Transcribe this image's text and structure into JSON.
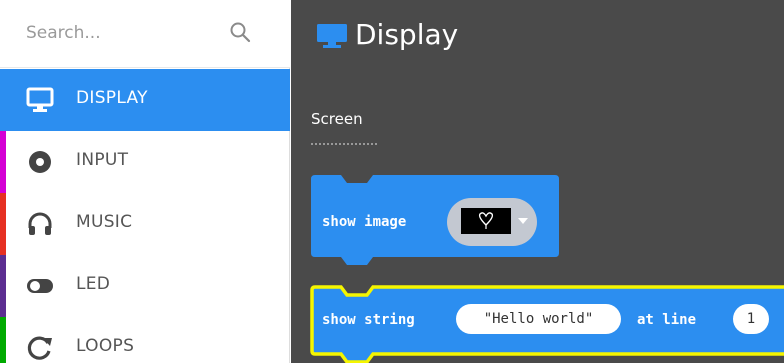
{
  "search": {
    "placeholder": "Search..."
  },
  "sidebar": {
    "items": [
      {
        "label": "DISPLAY",
        "icon": "monitor-icon",
        "color": "#2c8ef0",
        "active": true
      },
      {
        "label": "INPUT",
        "icon": "record-icon",
        "color": "#d400d4",
        "active": false
      },
      {
        "label": "MUSIC",
        "icon": "headphones-icon",
        "color": "#e63022",
        "active": false
      },
      {
        "label": "LED",
        "icon": "toggle-icon",
        "color": "#5c2d91",
        "active": false
      },
      {
        "label": "LOOPS",
        "icon": "loop-icon",
        "color": "#00aa00",
        "active": false
      }
    ]
  },
  "workspace": {
    "title": "Display",
    "section": "Screen",
    "blocks": [
      {
        "text": "show image",
        "color": "#2c8ef0"
      },
      {
        "text": "show string",
        "string_value": "\"Hello world\"",
        "text2": "at line",
        "line_value": "1",
        "color": "#2c8ef0",
        "highlight": "#f5f500"
      }
    ]
  }
}
